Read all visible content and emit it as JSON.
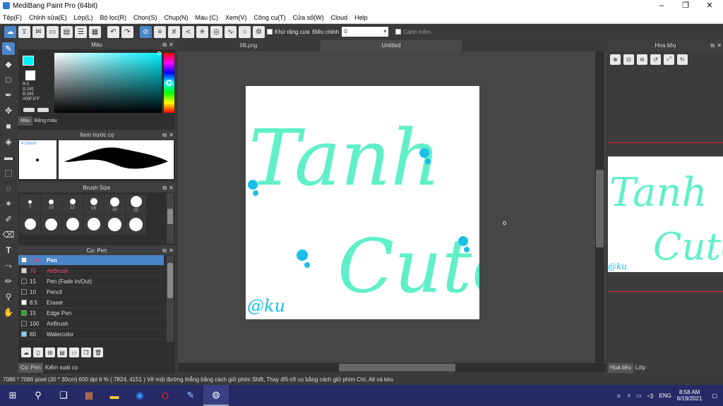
{
  "window": {
    "title": "MediBang Paint Pro (64bit)",
    "min_icon": "minimize-icon",
    "max_icon": "maximize-icon",
    "close_icon": "close-icon"
  },
  "menu": [
    "Tệp(F)",
    "Chỉnh sửa(E)",
    "Lớp(L)",
    "Bộ lọc(R)",
    "Chọn(S)",
    "Chụp(N)",
    "Màu (C)",
    "Xem(V)",
    "Công cụ(T)",
    "Cửa sổ(W)",
    "Cloud",
    "Help"
  ],
  "toolbar": {
    "antialias_label": "Khử răng cưa",
    "adjust_label": "Điều chỉnh",
    "adjust_value": "0",
    "edge_label": "Cạnh mềm"
  },
  "color_panel": {
    "title": "Màu",
    "foreground": "#00F1FF",
    "r": "R:0",
    "g": "G:241",
    "b": "B:255",
    "hex": "#00F1FF",
    "tabs": [
      "Màu",
      "Bảng màu"
    ]
  },
  "brush_preview": {
    "title": "Xem trước cọ",
    "size": "4.23mm"
  },
  "brush_size": {
    "title": "Brush Size",
    "sizes": [
      "7",
      "10",
      "12",
      "15",
      "20",
      "25",
      "",
      "",
      "",
      "",
      "",
      ""
    ]
  },
  "brush_list": {
    "title": "Cọ: Pen",
    "items": [
      {
        "size": "100",
        "name": "Pen",
        "color": "#ffffff"
      },
      {
        "size": "70",
        "name": "AirBrush",
        "color": "#d9d9d9"
      },
      {
        "size": "15",
        "name": "Pen (Fade In/Out)",
        "color": "#333333"
      },
      {
        "size": "10",
        "name": "Pencil",
        "color": "#333333"
      },
      {
        "size": "8.5",
        "name": "Eraser",
        "color": "#ffffff"
      },
      {
        "size": "15",
        "name": "Edge Pen",
        "color": "#22aa22"
      },
      {
        "size": "100",
        "name": "AirBrush",
        "color": "#333333"
      },
      {
        "size": "80",
        "name": "Watercolor",
        "color": "#7fd4f5"
      }
    ]
  },
  "left_bottom_tabs": [
    "Cọ: Pen",
    "Kiểm soát cọ"
  ],
  "doc_tabs": [
    "lllll.png",
    "Untitled"
  ],
  "canvas_art": {
    "line1": "Tanh",
    "line2": "Cute",
    "signature": "@ku"
  },
  "navigator": {
    "title": "Hoa tiêu",
    "tabs": [
      "Hoa tiêu",
      "Lớp"
    ]
  },
  "status": "7086 * 7086 pixel  (30 * 30cm)  600 dpi  6 %  ( 7824, 4151 )  Vẽ một đường thẳng bằng cách giữ phím Shift, Thay đổi cỡ cọ bằng cách giữ phím Ctrl, Alt và kéo",
  "taskbar": {
    "lang": "ENG",
    "time": "8:58 AM",
    "date": "6/19/2021"
  }
}
